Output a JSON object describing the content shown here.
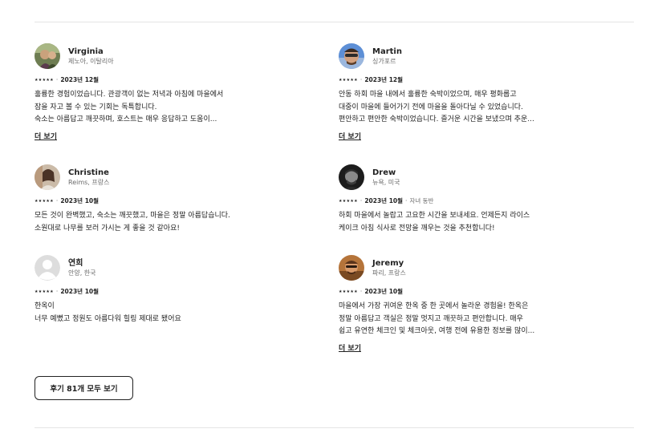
{
  "reviews": [
    {
      "name": "Virginia",
      "location": "제노아, 이탈리아",
      "stars": "★★★★★",
      "date": "2023년 12월",
      "stay": "",
      "text": "훌륭한 경험이었습니다. 관광객이 없는 저녁과 아침에 마을에서\n잠을 자고 볼 수 있는 기회는 독특합니다.\n숙소는 아름답고 깨끗하며, 호스트는 매우 응답하고 도움이...",
      "more": "더 보기"
    },
    {
      "name": "Martin",
      "location": "싱가포르",
      "stars": "★★★★★",
      "date": "2023년 12월",
      "stay": "",
      "text": "안동 하회 마을 내에서 훌륭한 숙박이었으며, 매우 평화롭고\n대중이 마을에 들어가기 전에 마을을 돌아다닐 수 있었습니다.\n편안하고 편안한 숙박이었습니다. 즐거운 시간을 보냈으며 추운...",
      "more": "더 보기"
    },
    {
      "name": "Christine",
      "location": "Reims, 프랑스",
      "stars": "★★★★★",
      "date": "2023년 10월",
      "stay": "",
      "text": "모든 것이 완벽했고, 숙소는 깨끗했고, 마을은 정말 아름답습니다.\n소원대로 나무를 보러 가시는 게 좋을 것 같아요!",
      "more": ""
    },
    {
      "name": "Drew",
      "location": "뉴욕, 미국",
      "stars": "★★★★★",
      "date": "2023년 10월",
      "stay": "자녀 동반",
      "text": "하회 마을에서 놀랍고 고요한 시간을 보내세요. 언제든지 라이스\n케이크 아침 식사로 전망을 깨우는 것을 추천합니다!",
      "more": ""
    },
    {
      "name": "연희",
      "location": "안양, 한국",
      "stars": "★★★★★",
      "date": "2023년 10월",
      "stay": "",
      "text": "한옥이\n너무 예뻤고 정원도 아름다워 힐링 제대로 됐어요",
      "more": ""
    },
    {
      "name": "Jeremy",
      "location": "파리, 프랑스",
      "stars": "★★★★★",
      "date": "2023년 10월",
      "stay": "",
      "text": "마을에서 가장 귀여운 한옥 중 한 곳에서 놀라운 경험을! 한옥은\n정말 아름답고 객실은 정말 멋지고 깨끗하고 편안합니다. 매우\n쉽고 유연한 체크인 및 체크아웃, 여행 전에 유용한 정보를 많이...",
      "more": "더 보기"
    }
  ],
  "show_all_label": "후기 81개 모두 보기"
}
